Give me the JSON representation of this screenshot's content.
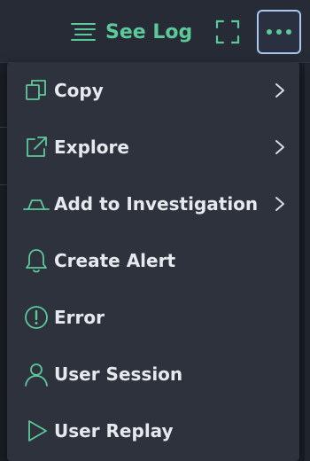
{
  "toolbar": {
    "see_log_label": "See Log",
    "see_log_icon": "log-lines-icon",
    "expand_icon": "expand-icon",
    "more_icon": "more-horizontal-icon"
  },
  "menu": {
    "items": [
      {
        "label": "Copy",
        "icon": "copy-icon",
        "has_submenu": true
      },
      {
        "label": "Explore",
        "icon": "external-link-icon",
        "has_submenu": true
      },
      {
        "label": "Add to Investigation",
        "icon": "investigation-icon",
        "has_submenu": true
      },
      {
        "label": "Create Alert",
        "icon": "bell-icon",
        "has_submenu": false
      },
      {
        "label": "Error",
        "icon": "error-circle-icon",
        "has_submenu": false
      },
      {
        "label": "User Session",
        "icon": "user-icon",
        "has_submenu": false
      },
      {
        "label": "User Replay",
        "icon": "play-icon",
        "has_submenu": false
      }
    ]
  },
  "colors": {
    "accent": "#5cc99a",
    "menu_bg": "#2d323c",
    "text": "#e6e9ee",
    "focus_ring": "#a8c8f0"
  }
}
